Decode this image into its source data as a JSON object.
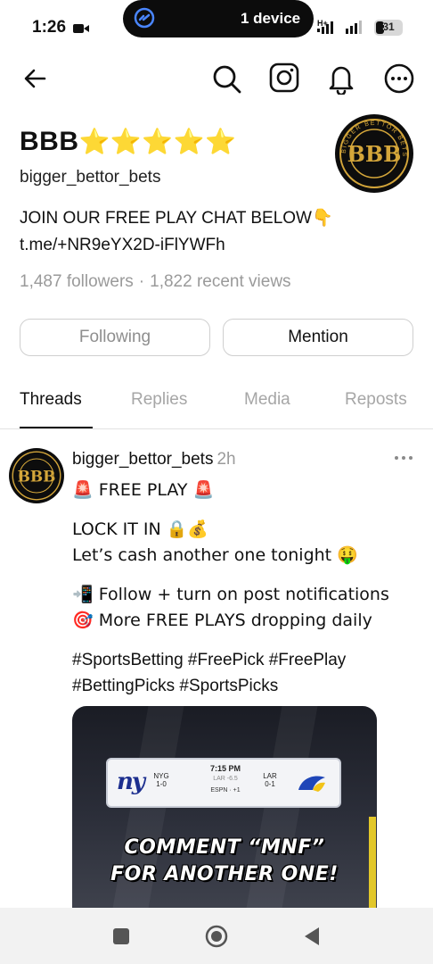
{
  "status_bar": {
    "time": "1:26",
    "island_text": "1 device",
    "network_label": "H+",
    "battery": "31",
    "battery_fraction": 0.31
  },
  "nav": {
    "icons": [
      "back-arrow-icon",
      "search-icon",
      "instagram-icon",
      "bell-icon",
      "more-icon"
    ]
  },
  "profile": {
    "name": "BBB",
    "name_stars": "⭐⭐⭐⭐⭐",
    "username": "bigger_bettor_bets",
    "bio_line1": "JOIN OUR FREE PLAY CHAT BELOW👇",
    "bio_line2": "t.me/+NR9eYX2D-iFlYWFh",
    "followers": "1,487 followers",
    "separator": "·",
    "views": "1,822 recent views",
    "avatar_text": "BBB",
    "avatar_ring_text": "BIGGER BETTOR BETS"
  },
  "buttons": {
    "following": "Following",
    "mention": "Mention"
  },
  "tabs": [
    {
      "label": "Threads",
      "active": true
    },
    {
      "label": "Replies",
      "active": false
    },
    {
      "label": "Media",
      "active": false
    },
    {
      "label": "Reposts",
      "active": false
    }
  ],
  "post": {
    "author": "bigger_bettor_bets",
    "time": "2h",
    "lines": [
      "🚨 FREE PLAY 🚨",
      "LOCK IT IN 🔒💰",
      "Let’s cash another one tonight 🤑",
      "📲 Follow + turn on post notifications",
      "🎯 More FREE PLAYS dropping daily",
      "#SportsBetting #FreePick #FreePlay",
      "#BettingPicks #SportsPicks"
    ],
    "media": {
      "scorebug": {
        "time": "7:15 PM",
        "line": "LAR -6.5",
        "network": "ESPN · +1",
        "home_team": "NYG",
        "home_record": "1-0",
        "away_team": "LAR",
        "away_record": "0-1",
        "home_logo_text": "ny"
      },
      "caption_line1": "COMMENT “MNF”",
      "caption_line2": "FOR ANOTHER ONE!"
    }
  },
  "colors": {
    "accent_gold": "#f5c518",
    "muted_text": "#9a9a9a",
    "island_bg": "#0c0c0c"
  }
}
